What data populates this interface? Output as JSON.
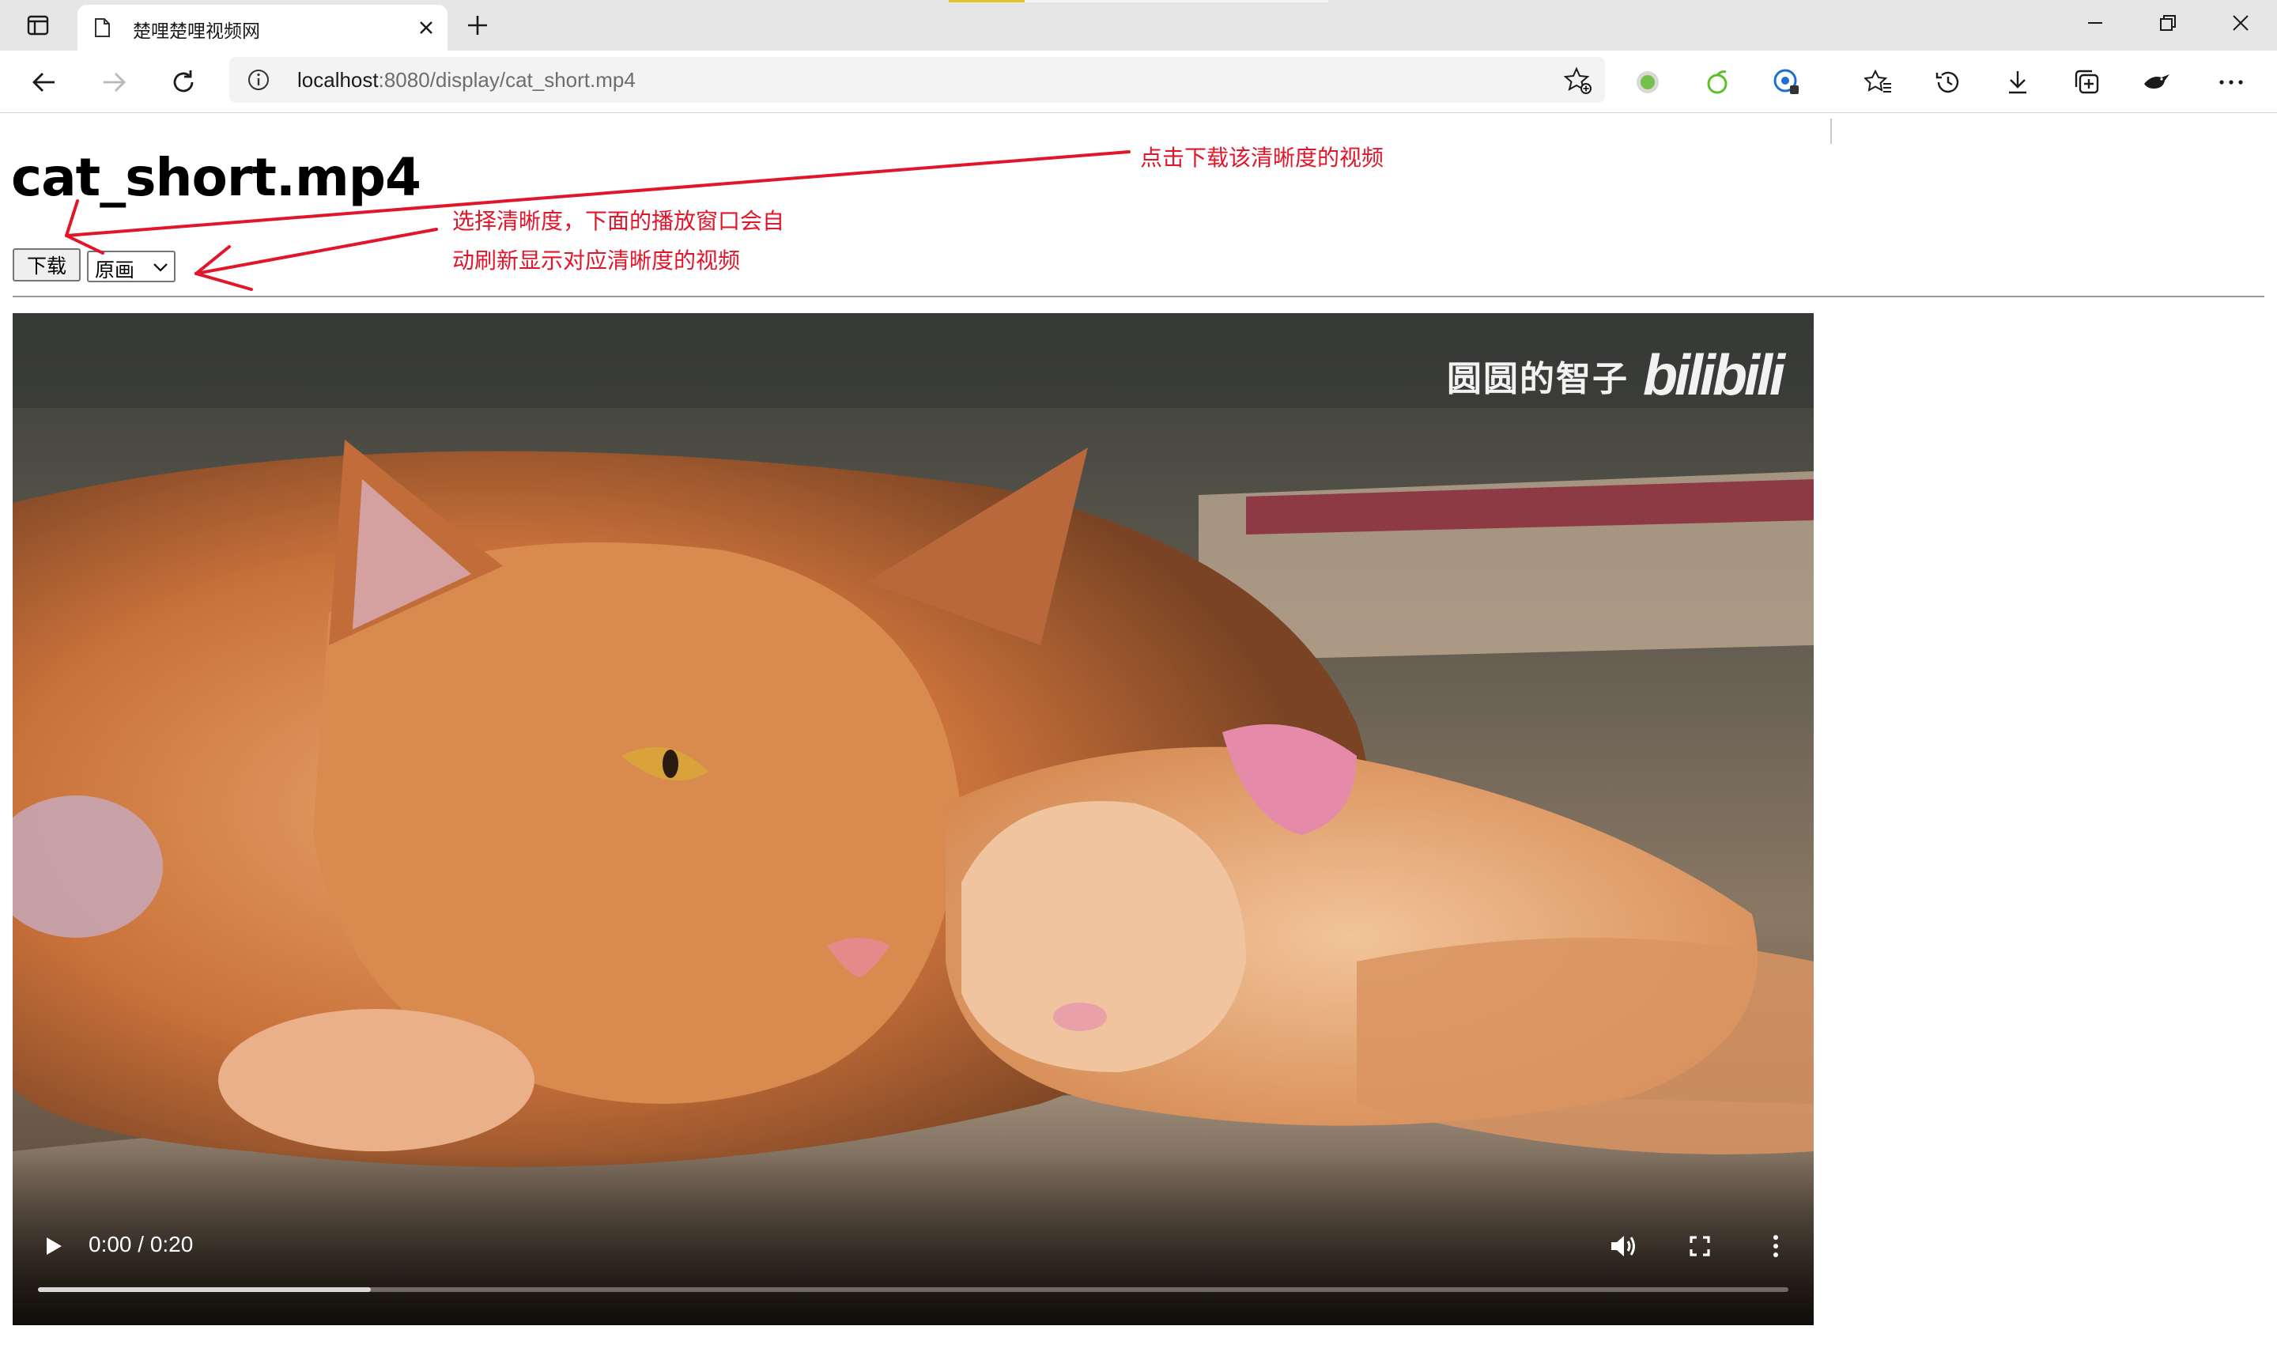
{
  "browser": {
    "tab_title": "楚哩楚哩视频网",
    "url_host": "localhost",
    "url_rest": ":8080/display/cat_short.mp4",
    "icons": [
      "tab-actions-icon",
      "document-icon",
      "close-icon",
      "plus-icon",
      "minimize-icon",
      "restore-icon",
      "close-window-icon",
      "back-icon",
      "forward-icon",
      "refresh-icon",
      "info-icon",
      "add-favorite-icon",
      "extension-green-icon",
      "extension-leaf-icon",
      "extension-profile-icon",
      "favorites-icon",
      "history-icon",
      "download-icon",
      "collections-icon",
      "extension-bird-icon",
      "more-icon"
    ]
  },
  "page": {
    "title": "cat_short.mp4",
    "download_label": "下载",
    "quality_selected": "原画"
  },
  "annotations": {
    "download_note": "点击下载该清晰度的视频",
    "select_note_line1": "选择清晰度，下面的播放窗口会自",
    "select_note_line2": "动刷新显示对应清晰度的视频"
  },
  "video": {
    "watermark_text": "圆圆的智子",
    "watermark_logo": "bilibili",
    "time_display": "0:00 / 0:20",
    "buffered_fraction": 0.19
  },
  "colors": {
    "annotation_red": "#e2162a",
    "chrome_bg": "#e6e6e6"
  }
}
